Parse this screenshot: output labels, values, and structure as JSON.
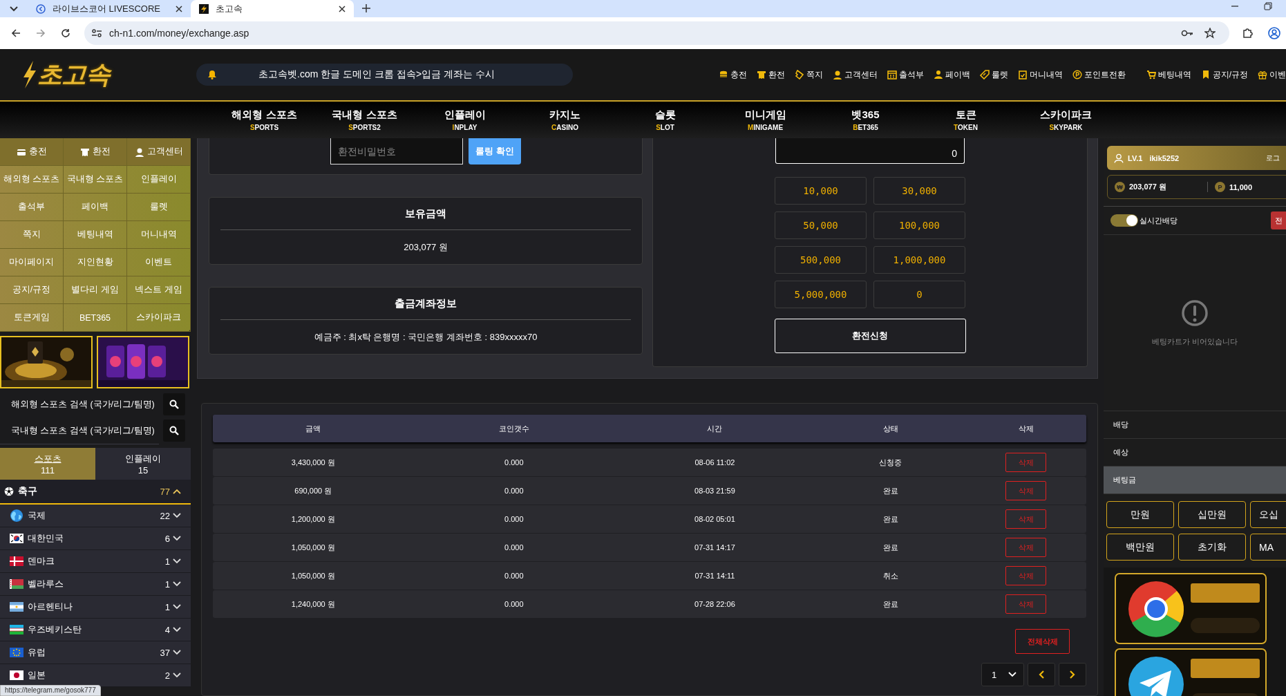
{
  "browser": {
    "tabs": [
      {
        "title": "라이브스코어 LIVESCORE",
        "selected": false
      },
      {
        "title": "초고속",
        "selected": true
      }
    ],
    "url": "ch-n1.com/money/exchange.asp"
  },
  "header": {
    "logo": "초고속",
    "notice": "초고속벳.com 한글 도메인 크롬 접속>입금 계좌는 수시",
    "links": [
      {
        "label": "충전",
        "kind": "coins"
      },
      {
        "label": "환전",
        "kind": "receipt"
      },
      {
        "label": "쪽지",
        "kind": "ticket"
      },
      {
        "label": "고객센터",
        "kind": "agent"
      },
      {
        "label": "출석부",
        "kind": "calendar"
      },
      {
        "label": "페이백",
        "kind": "person"
      },
      {
        "label": "룰렛",
        "kind": "tag"
      },
      {
        "label": "머니내역",
        "kind": "clipboard"
      },
      {
        "label": "포인트전환",
        "kind": "point"
      },
      {
        "label": "베팅내역",
        "kind": "cart"
      },
      {
        "label": "공지/규정",
        "kind": "bookmark"
      },
      {
        "label": "이벤",
        "kind": "gift"
      }
    ]
  },
  "nav": [
    {
      "label": "해외형 스포츠",
      "sub": "SPORTS"
    },
    {
      "label": "국내형 스포츠",
      "sub": "SPORTS2"
    },
    {
      "label": "인플레이",
      "sub": "INPLAY"
    },
    {
      "label": "카지노",
      "sub": "CASINO"
    },
    {
      "label": "슬롯",
      "sub": "SLOT"
    },
    {
      "label": "미니게임",
      "sub": "MINIGAME"
    },
    {
      "label": "벳365",
      "sub": "BET365"
    },
    {
      "label": "토큰",
      "sub": "TOKEN"
    },
    {
      "label": "스카이파크",
      "sub": "SKYPARK"
    }
  ],
  "sidebar": {
    "top_buttons": [
      {
        "label": "충전",
        "kind": "card"
      },
      {
        "label": "환전",
        "kind": "receipt"
      },
      {
        "label": "고객센터",
        "kind": "agent"
      }
    ],
    "menu": [
      "해외형 스포츠",
      "국내형 스포츠",
      "인플레이",
      "출석부",
      "페이백",
      "룰렛",
      "쪽지",
      "베팅내역",
      "머니내역",
      "마이페이지",
      "지인현황",
      "이벤트",
      "공지/규정",
      "별다리 게임",
      "넥스트 게임",
      "토큰게임",
      "BET365",
      "스카이파크"
    ],
    "searches": [
      {
        "placeholder": "해외형 스포츠 검색 (국가/리그/팀명)"
      },
      {
        "placeholder": "국내형 스포츠 검색 (국가/리그/팀명)"
      }
    ],
    "tabs": [
      {
        "label": "스포츠",
        "count": "111",
        "selected": true
      },
      {
        "label": "인플레이",
        "count": "15",
        "selected": false
      }
    ],
    "sport": {
      "name": "축구",
      "count": "77",
      "expanded": true
    },
    "leagues": [
      {
        "name": "국제",
        "count": "22",
        "kind": "globe",
        "expanded": false
      },
      {
        "name": "대한민국",
        "count": "6",
        "kind": "kr",
        "expanded": false
      },
      {
        "name": "덴마크",
        "count": "1",
        "kind": "dk",
        "expanded": false
      },
      {
        "name": "벨라루스",
        "count": "1",
        "kind": "by",
        "expanded": false
      },
      {
        "name": "아르헨티나",
        "count": "1",
        "kind": "ar",
        "expanded": false
      },
      {
        "name": "우즈베키스탄",
        "count": "4",
        "kind": "uz",
        "expanded": false
      },
      {
        "name": "유럽",
        "count": "37",
        "kind": "eu",
        "expanded": false
      },
      {
        "name": "일본",
        "count": "2",
        "kind": "jp",
        "expanded": false
      }
    ]
  },
  "exchange": {
    "password": {
      "placeholder": "환전비밀번호"
    },
    "rolling_button": "롤링 확인",
    "balance": {
      "title": "보유금액",
      "value": "203,077 원"
    },
    "account": {
      "title": "출금계좌정보",
      "value": "예금주 : 최x탁 은행명 : 국민은행 계좌번호 : 839xxxxx70"
    },
    "amount": {
      "value": "0"
    },
    "presets": [
      "10,000",
      "30,000",
      "50,000",
      "100,000",
      "500,000",
      "1,000,000",
      "5,000,000",
      "0"
    ],
    "submit": "환전신청"
  },
  "history": {
    "columns": [
      "금액",
      "코인갯수",
      "시간",
      "상태",
      "삭제"
    ],
    "rows": [
      [
        "3,430,000 원",
        "0.000",
        "08-06 11:02",
        "신청중",
        "삭제"
      ],
      [
        "690,000 원",
        "0.000",
        "08-03 21:59",
        "완료",
        "삭제"
      ],
      [
        "1,200,000 원",
        "0.000",
        "08-02 05:01",
        "완료",
        "삭제"
      ],
      [
        "1,050,000 원",
        "0.000",
        "07-31 14:17",
        "완료",
        "삭제"
      ],
      [
        "1,050,000 원",
        "0.000",
        "07-31 14:11",
        "취소",
        "삭제"
      ],
      [
        "1,240,000 원",
        "0.000",
        "07-28 22:06",
        "완료",
        "삭제"
      ]
    ],
    "delete_all": "전체삭제",
    "page": "1"
  },
  "betslip": {
    "level": "LV.1",
    "user": "ikik5252",
    "logout": "로그",
    "money": "203,077 원",
    "money_badge": "₩",
    "points": "11,000",
    "points_badge": "P",
    "live_odds": {
      "label": "실시간배당",
      "on": true
    },
    "clear": "전",
    "empty": "베팅카트가 비어있습니다",
    "rows": [
      {
        "label": "배당",
        "highlighted": false
      },
      {
        "label": "예상",
        "highlighted": false
      },
      {
        "label": "베팅금",
        "highlighted": true
      }
    ],
    "amounts": [
      "만원",
      "십만원",
      "오십",
      "백만원",
      "초기화",
      "MA"
    ]
  },
  "status_url": "https://telegram.me/gosok777"
}
